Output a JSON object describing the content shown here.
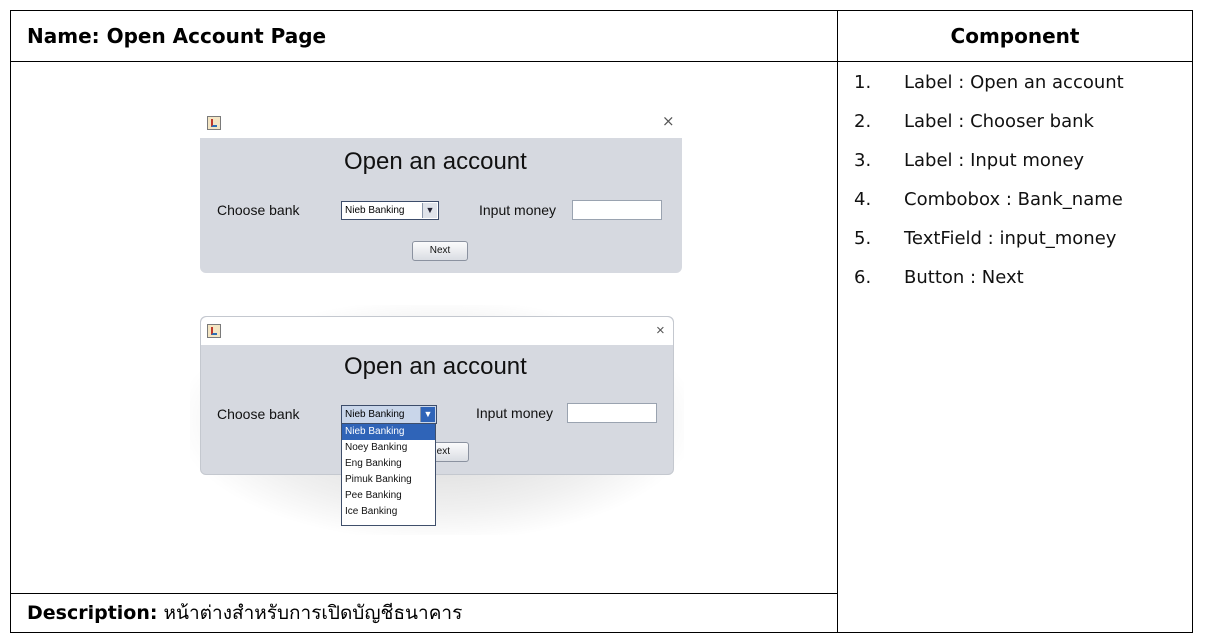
{
  "header": {
    "name_label": "Name: Open Account Page",
    "component_label": "Component"
  },
  "components": [
    {
      "num": "1.",
      "text": "Label : Open an account"
    },
    {
      "num": "2.",
      "text": "Label : Chooser bank"
    },
    {
      "num": "3.",
      "text": "Label : Input money"
    },
    {
      "num": "4.",
      "text": "Combobox : Bank_name"
    },
    {
      "num": "5.",
      "text": "TextField : input_money"
    },
    {
      "num": "6.",
      "text": "Button : Next"
    }
  ],
  "description": {
    "label": "Description:",
    "text": "หน้าต่างสำหรับการเปิดบัญชีธนาคาร"
  },
  "window1": {
    "close_glyph": "×",
    "title": "Open an account",
    "choose_bank_label": "Choose bank",
    "combo_value": "Nieb Banking",
    "input_money_label": "Input money",
    "input_money_value": "",
    "next_label": "Next"
  },
  "window2": {
    "close_glyph": "×",
    "title": "Open an account",
    "choose_bank_label": "Choose bank",
    "combo_value": "Nieb Banking",
    "input_money_label": "Input money",
    "input_money_value": "",
    "next_label_visible": "ext",
    "dropdown_options": [
      "Nieb Banking",
      "Noey Banking",
      "Eng Banking",
      "Pimuk Banking",
      "Pee Banking",
      "Ice Banking"
    ],
    "selected_index": 0
  },
  "icons": {
    "java": "java-app-icon",
    "close": "close-icon",
    "combo_arrow": "chevron-down-icon"
  },
  "colors": {
    "window_bg": "#d6d9e0",
    "selection": "#2f64b8"
  }
}
